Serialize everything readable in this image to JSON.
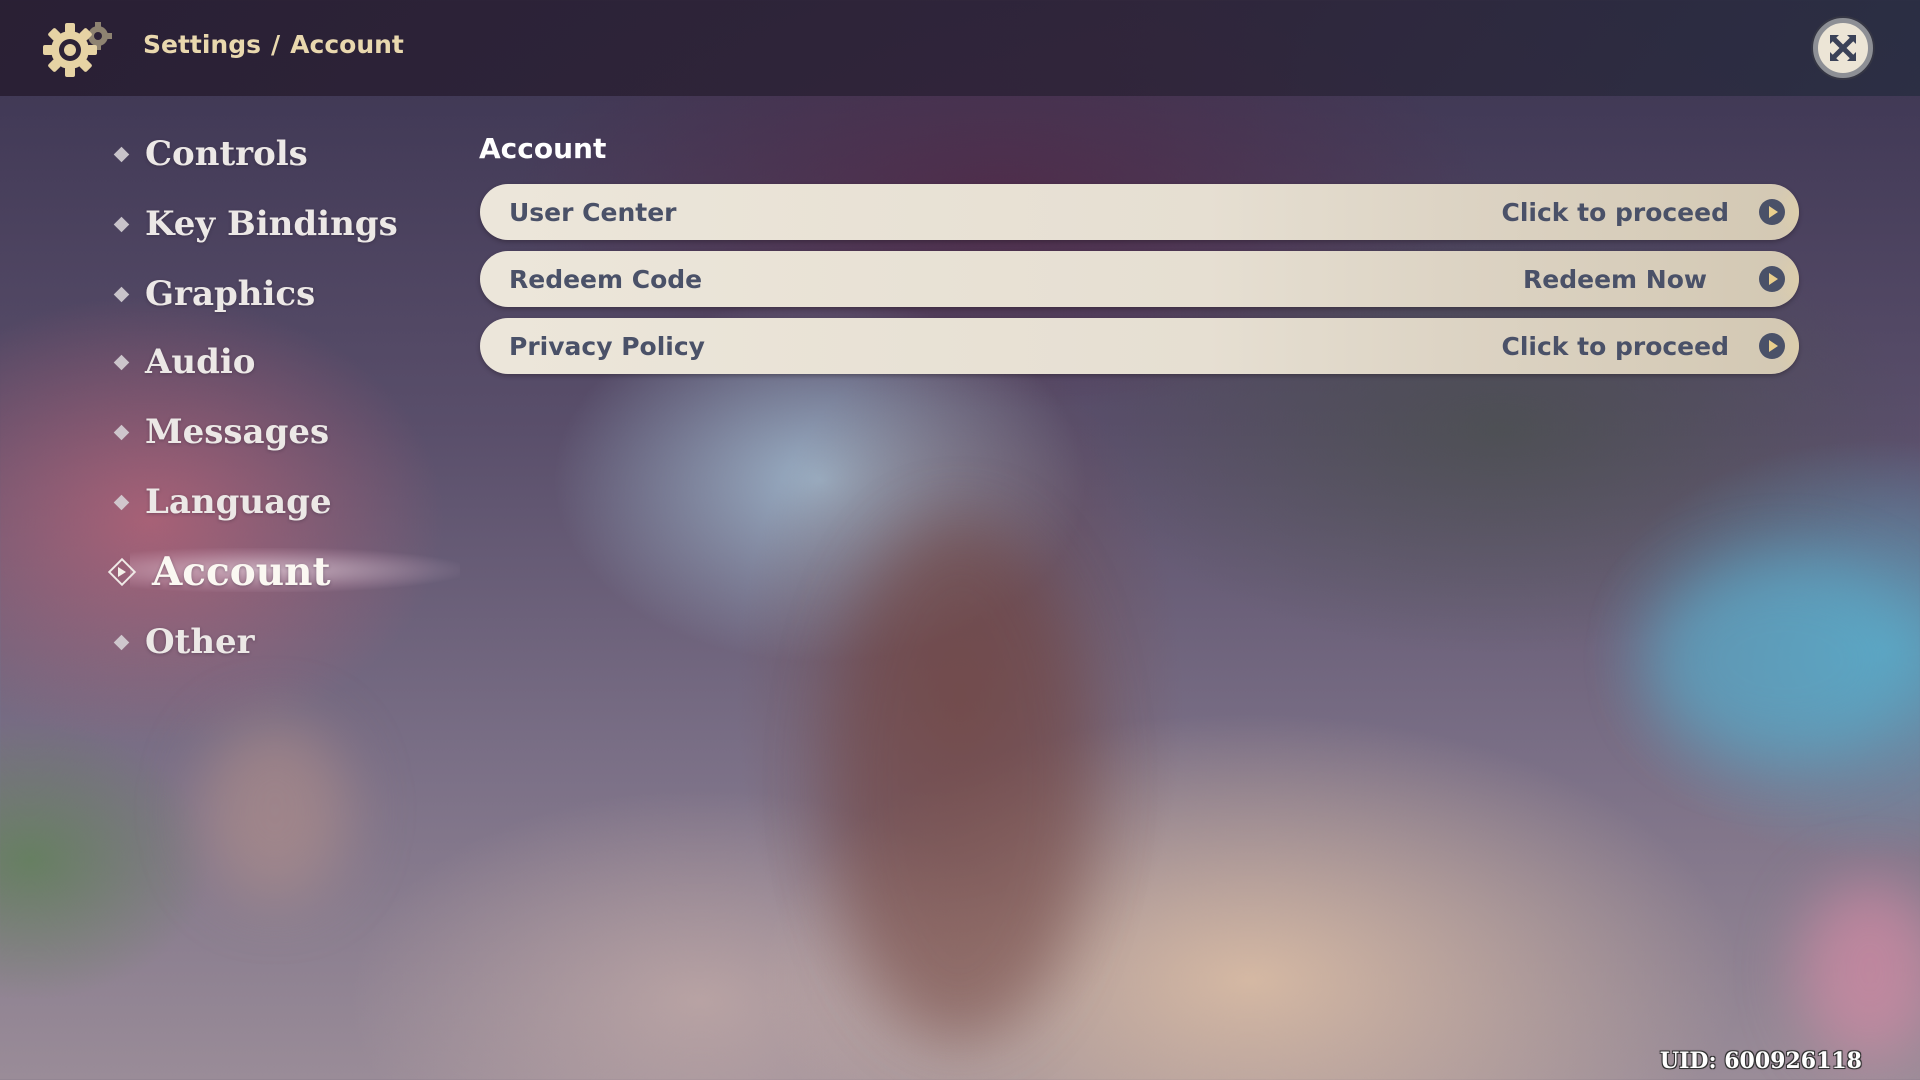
{
  "header": {
    "icon": "gear-icon",
    "breadcrumb": {
      "root": "Settings",
      "separator": "/",
      "current": "Account"
    },
    "close_icon": "close-x-icon"
  },
  "sidebar": {
    "items": [
      {
        "label": "Controls",
        "active": false
      },
      {
        "label": "Key Bindings",
        "active": false
      },
      {
        "label": "Graphics",
        "active": false
      },
      {
        "label": "Audio",
        "active": false
      },
      {
        "label": "Messages",
        "active": false
      },
      {
        "label": "Language",
        "active": false
      },
      {
        "label": "Account",
        "active": true
      },
      {
        "label": "Other",
        "active": false
      }
    ]
  },
  "main": {
    "section_title": "Account",
    "rows": [
      {
        "label": "User Center",
        "action": "Click to proceed",
        "icon": "arrow-right-circle-icon"
      },
      {
        "label": "Redeem Code",
        "action": "Redeem Now",
        "icon": "arrow-right-circle-icon"
      },
      {
        "label": "Privacy Policy",
        "action": "Click to proceed",
        "icon": "arrow-right-circle-icon"
      }
    ]
  },
  "footer": {
    "uid": "UID: 600926118"
  },
  "colors": {
    "breadcrumb": "#e9d8ae",
    "row_text": "#4a5168",
    "row_background": "#ece6da",
    "accent_gold": "#e9cf8d"
  }
}
